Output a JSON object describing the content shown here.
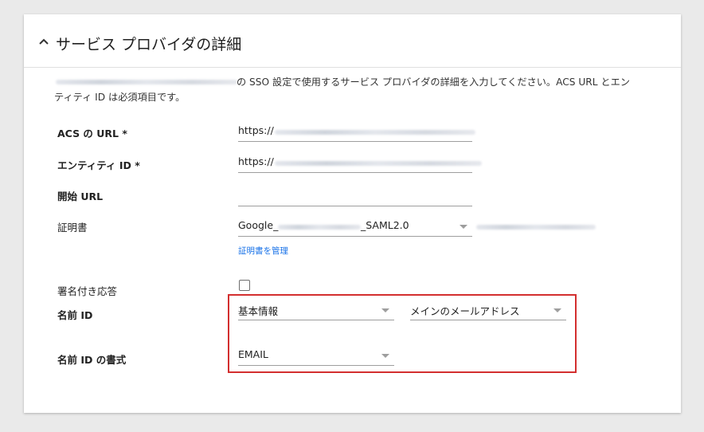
{
  "header": {
    "title": "サービス プロバイダの詳細"
  },
  "description": {
    "line1": "の SSO 設定で使用するサービス プロバイダの詳細を入力してください。ACS URL とエン",
    "line2": "ティティ ID は必須項目です。"
  },
  "fields": {
    "acs_url": {
      "label": "ACS の URL *",
      "value": "https://"
    },
    "entity_id": {
      "label": "エンティティ ID *",
      "value": "https://"
    },
    "start_url": {
      "label": "開始 URL",
      "value": ""
    },
    "certificate": {
      "label": "証明書",
      "value_prefix": "Google_",
      "value_suffix": "_SAML2.0",
      "manage_link": "証明書を管理"
    },
    "signed_response": {
      "label": "署名付き応答",
      "checked": false
    },
    "name_id": {
      "label": "名前 ID",
      "select1": "基本情報",
      "select2": "メインのメールアドレス"
    },
    "name_id_format": {
      "label": "名前 ID の書式",
      "value": "EMAIL"
    }
  },
  "colors": {
    "highlight_border": "#d32f2f",
    "link": "#1a73e8"
  },
  "icons": [
    "chevron-up-icon",
    "dropdown-arrow-icon",
    "checkbox-icon"
  ]
}
